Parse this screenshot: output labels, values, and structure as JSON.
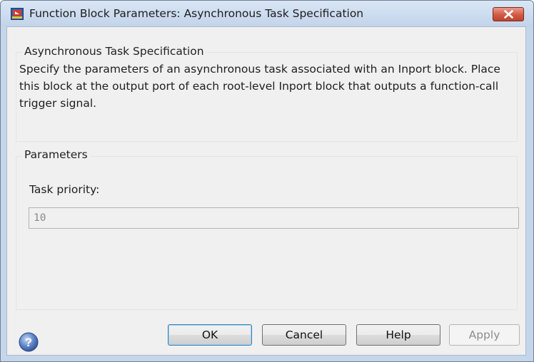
{
  "window": {
    "title": "Function Block Parameters: Asynchronous Task Specification",
    "icon": "simulink-block-icon"
  },
  "description_group": {
    "title": "Asynchronous Task Specification",
    "text": "Specify the parameters of an asynchronous task associated with an Inport block. Place this block at the output port of each root-level Inport block that outputs a function-call trigger signal."
  },
  "parameters_group": {
    "title": "Parameters",
    "task_priority": {
      "label": "Task priority:",
      "value": "10"
    }
  },
  "buttons": {
    "ok": "OK",
    "cancel": "Cancel",
    "help": "Help",
    "apply": "Apply"
  },
  "colors": {
    "titlebar": "#c8d8ec",
    "close_button": "#d15a43",
    "dialog_background": "#f0f0f0",
    "default_button_border": "#3c7fb1"
  }
}
